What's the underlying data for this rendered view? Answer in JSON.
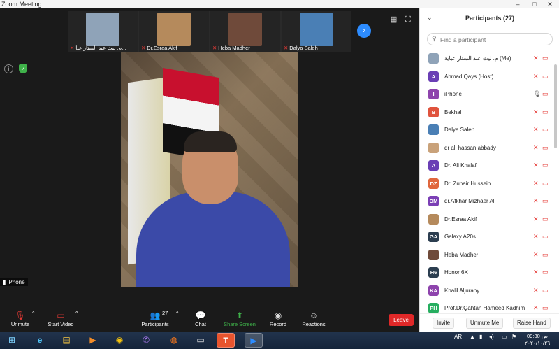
{
  "window": {
    "title": "Zoom Meeting",
    "controls": [
      "–",
      "□",
      "✕"
    ]
  },
  "thumbnails": [
    {
      "name": "م. ليث عبد الستار عبا...",
      "color": "#8fa3b8"
    },
    {
      "name": "Dr.Esraa Akif",
      "color": "#b58a5c"
    },
    {
      "name": "Heba Madher",
      "color": "#6f4a3a"
    },
    {
      "name": "Dalya Saleh",
      "color": "#4a7fb5"
    }
  ],
  "next_icon": "chevron-right-icon",
  "iphone_label": "iPhone",
  "toolbar": {
    "unmute": "Unmute",
    "start_video": "Start Video",
    "participants": "Participants",
    "participants_count": "27",
    "chat": "Chat",
    "share_screen": "Share Screen",
    "record": "Record",
    "reactions": "Reactions",
    "leave": "Leave"
  },
  "panel": {
    "title": "Participants (27)",
    "search_placeholder": "Find a participant",
    "participants": [
      {
        "name": "م. ليث عبد الستار عباية (Me)",
        "initials": "",
        "color": "#8fa3b8",
        "mic": "muted"
      },
      {
        "name": "Ahmad Qays (Host)",
        "initials": "A",
        "color": "#6a3fb5",
        "mic": "muted"
      },
      {
        "name": "iPhone",
        "initials": "I",
        "color": "#8e44ad",
        "mic": "on"
      },
      {
        "name": "Bekhal",
        "initials": "B",
        "color": "#e0533d",
        "mic": "muted"
      },
      {
        "name": "Dalya Saleh",
        "initials": "",
        "color": "#4a7fb5",
        "mic": "muted"
      },
      {
        "name": "dr ali hassan abbady",
        "initials": "",
        "color": "#c9a27a",
        "mic": "muted"
      },
      {
        "name": "Dr. Ali Khalaf",
        "initials": "A",
        "color": "#6a3fb5",
        "mic": "muted"
      },
      {
        "name": "Dr. Zuhair Hussein",
        "initials": "DZ",
        "color": "#e0673d",
        "mic": "muted"
      },
      {
        "name": "dr.Afkhar Mizhaer Ali",
        "initials": "DM",
        "color": "#7b3fb5",
        "mic": "muted"
      },
      {
        "name": "Dr.Esraa Akif",
        "initials": "",
        "color": "#b58a5c",
        "mic": "muted"
      },
      {
        "name": "Galaxy A20s",
        "initials": "GA",
        "color": "#2c3e50",
        "mic": "muted"
      },
      {
        "name": "Heba Madher",
        "initials": "",
        "color": "#6f4a3a",
        "mic": "muted"
      },
      {
        "name": "Honor 6X",
        "initials": "H6",
        "color": "#2c3e50",
        "mic": "muted"
      },
      {
        "name": "Khalil Aljurany",
        "initials": "KA",
        "color": "#8e44ad",
        "mic": "muted"
      },
      {
        "name": "Prof.Dr.Qahtan Hameed Kadhim",
        "initials": "PH",
        "color": "#27ae60",
        "mic": "muted"
      }
    ],
    "footer": {
      "invite": "Invite",
      "unmute_me": "Unmute Me",
      "raise_hand": "Raise Hand"
    }
  },
  "taskbar": {
    "apps": [
      {
        "icon": "windows-start-icon",
        "glyph": "⊞"
      },
      {
        "icon": "internet-explorer-icon",
        "glyph": "e"
      },
      {
        "icon": "file-explorer-icon",
        "glyph": "▤"
      },
      {
        "icon": "media-player-icon",
        "glyph": "▶"
      },
      {
        "icon": "chrome-icon",
        "glyph": "◉"
      },
      {
        "icon": "viber-icon",
        "glyph": "✆"
      },
      {
        "icon": "firefox-icon",
        "glyph": "◍"
      },
      {
        "icon": "document-icon",
        "glyph": "▭"
      },
      {
        "icon": "t-app-icon",
        "glyph": "T"
      },
      {
        "icon": "zoom-icon",
        "glyph": "▶"
      }
    ],
    "lang": "AR",
    "time": "09:30 ص",
    "date": "٢٠٢٠/١٠/٢٦"
  }
}
